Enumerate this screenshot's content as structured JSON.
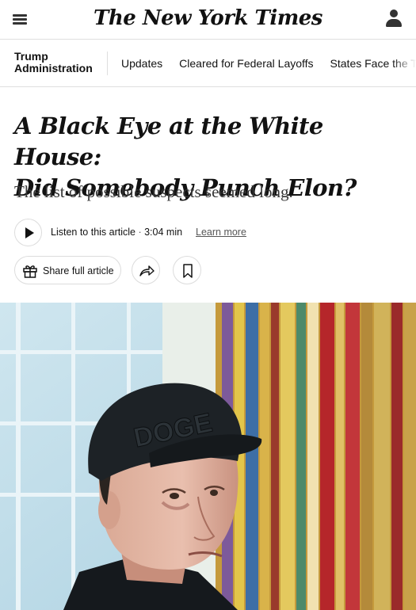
{
  "masthead": {
    "logo_text": "The New York Times",
    "menu_icon": "hamburger-menu-icon",
    "account_icon": "account-person-icon"
  },
  "subnav": {
    "section_line1": "Trump",
    "section_line2": "Administration",
    "links": [
      "Updates",
      "Cleared for Federal Layoffs",
      "States Face the Ta"
    ]
  },
  "article": {
    "headline_line1": "A Black Eye at the White House:",
    "headline_line2": "Did Somebody Punch Elon?",
    "summary": "The list of possible suspects seemed long.",
    "audio": {
      "listen_label": "Listen to this article",
      "separator": " · ",
      "duration": "3:04 min",
      "learn_more": "Learn more"
    },
    "share_label": "Share full article"
  },
  "hero_image": {
    "cap_text": "DOGE"
  },
  "colors": {
    "text": "#121212",
    "divider": "#dfdfdf",
    "muted": "#555555"
  }
}
